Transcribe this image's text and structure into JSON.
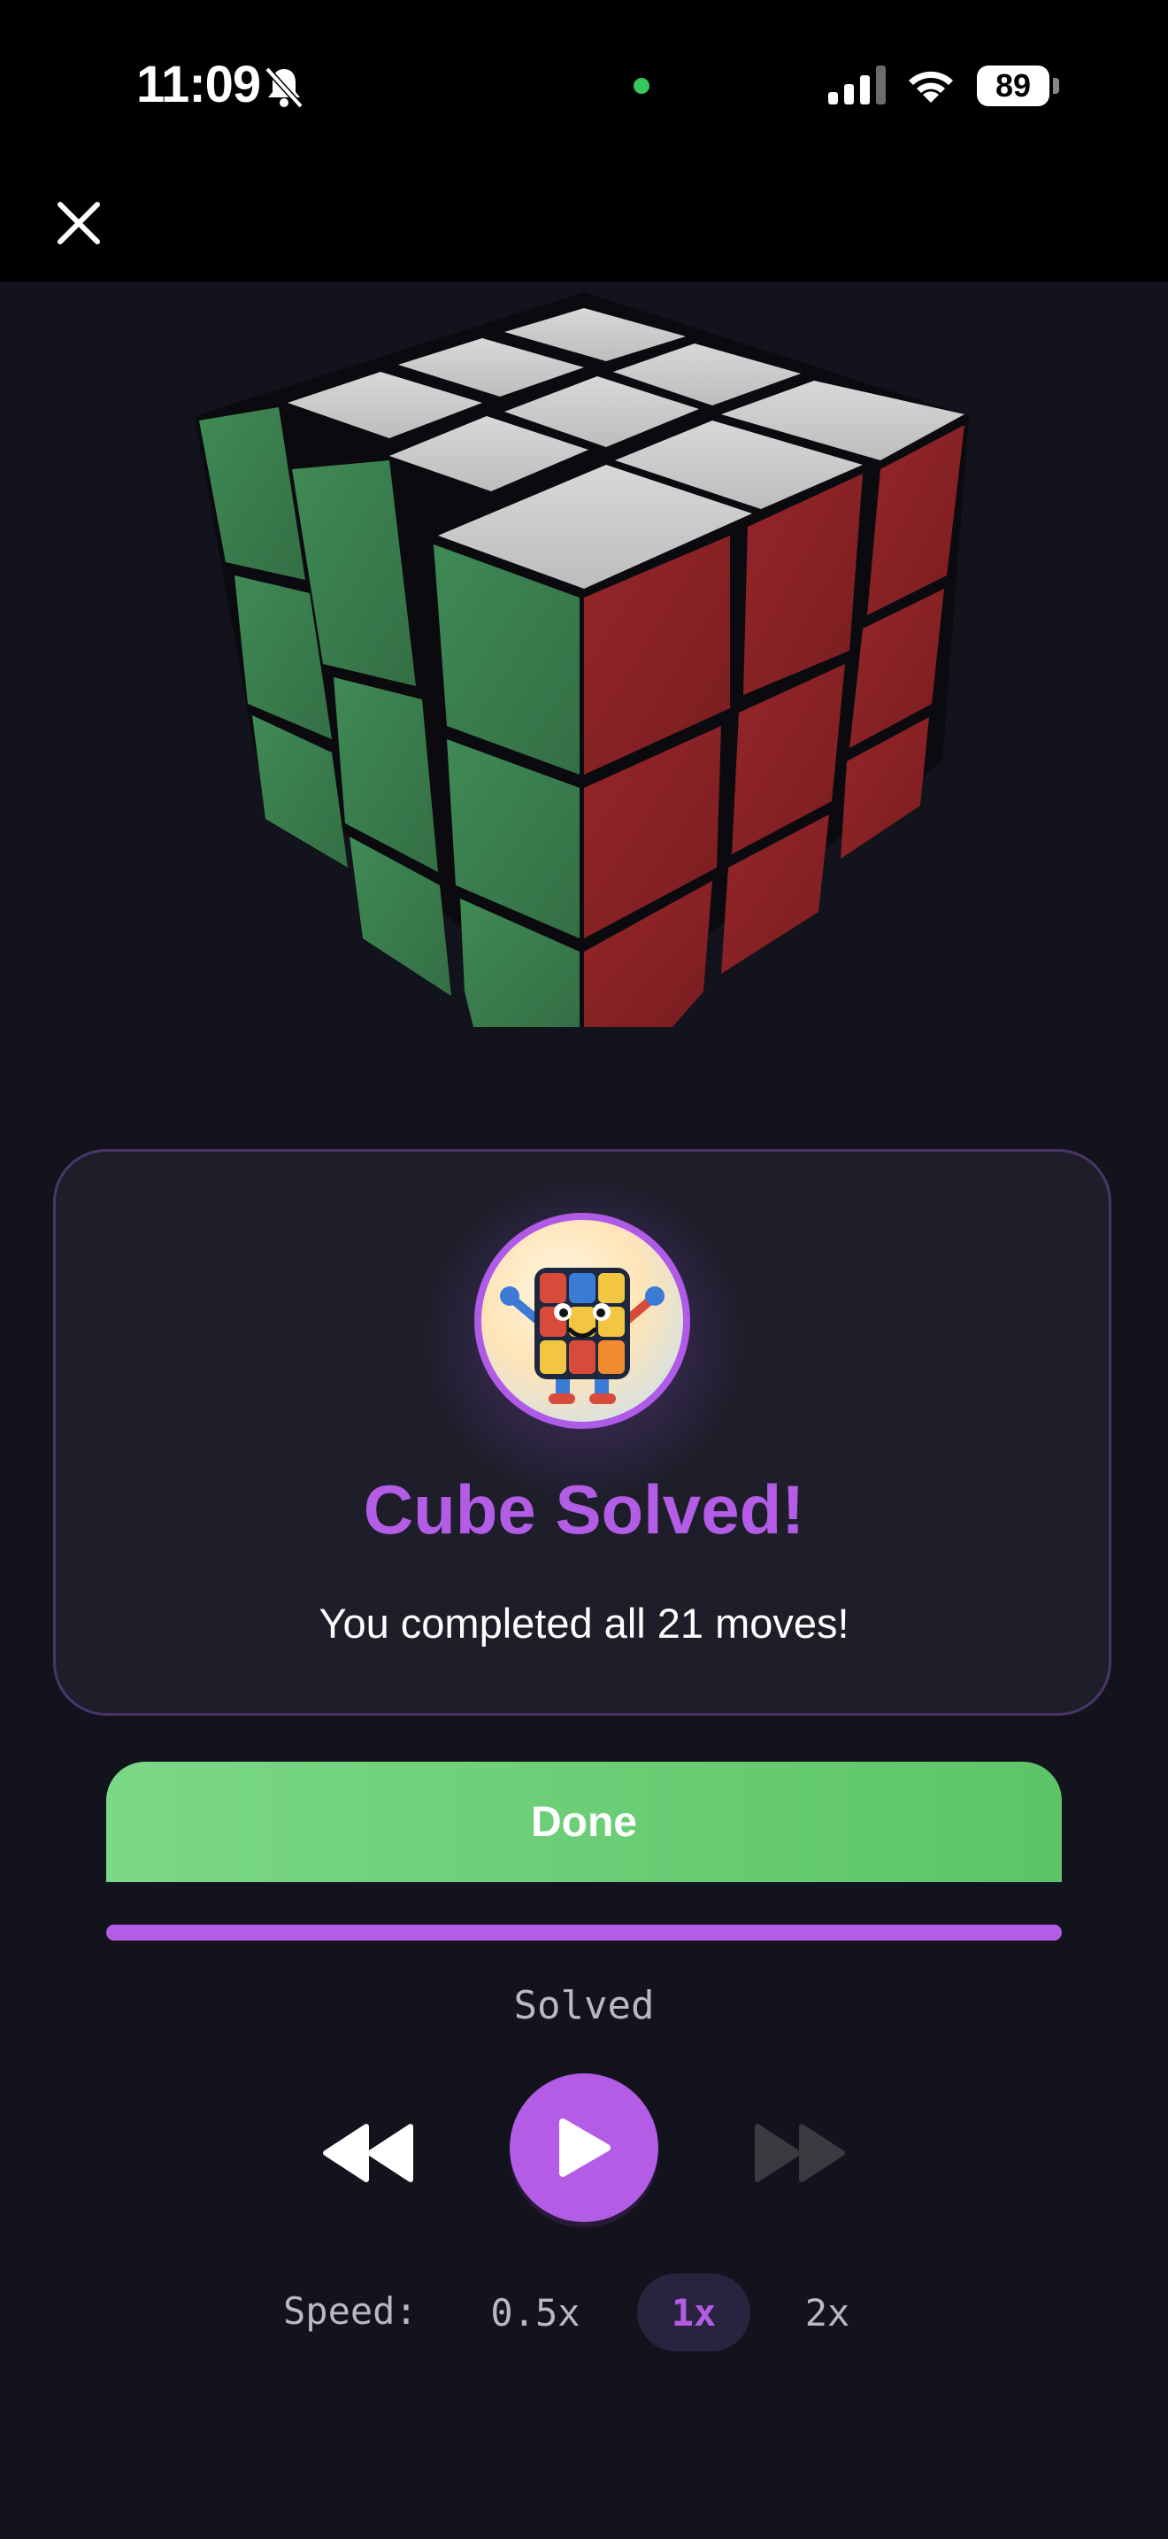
{
  "status_bar": {
    "time": "11:09",
    "battery": "89",
    "icons": [
      "bell-slash-icon",
      "signal-icon",
      "wifi-icon",
      "battery-icon"
    ]
  },
  "toolbar": {
    "close_icon": "close-icon"
  },
  "cube": {
    "state": "solved",
    "face_colors": {
      "top": "#c6c6c6",
      "left": "#3b7f4f",
      "right": "#8a2224"
    }
  },
  "result_card": {
    "avatar_icon": "cube-mascot-icon",
    "title": "Cube Solved!",
    "message": "You completed all 21 moves!"
  },
  "actions": {
    "done_label": "Done"
  },
  "playback": {
    "progress_fraction": 1.0,
    "status": "Solved",
    "controls": [
      "rewind-icon",
      "play-icon",
      "fast-forward-icon"
    ],
    "fast_forward_enabled": false
  },
  "speed": {
    "label": "Speed:",
    "options": [
      "0.5x",
      "1x",
      "2x"
    ],
    "selected": "1x"
  },
  "colors": {
    "accent": "#b35ce6",
    "done_green": "#5cc467",
    "background": "#12131c"
  }
}
